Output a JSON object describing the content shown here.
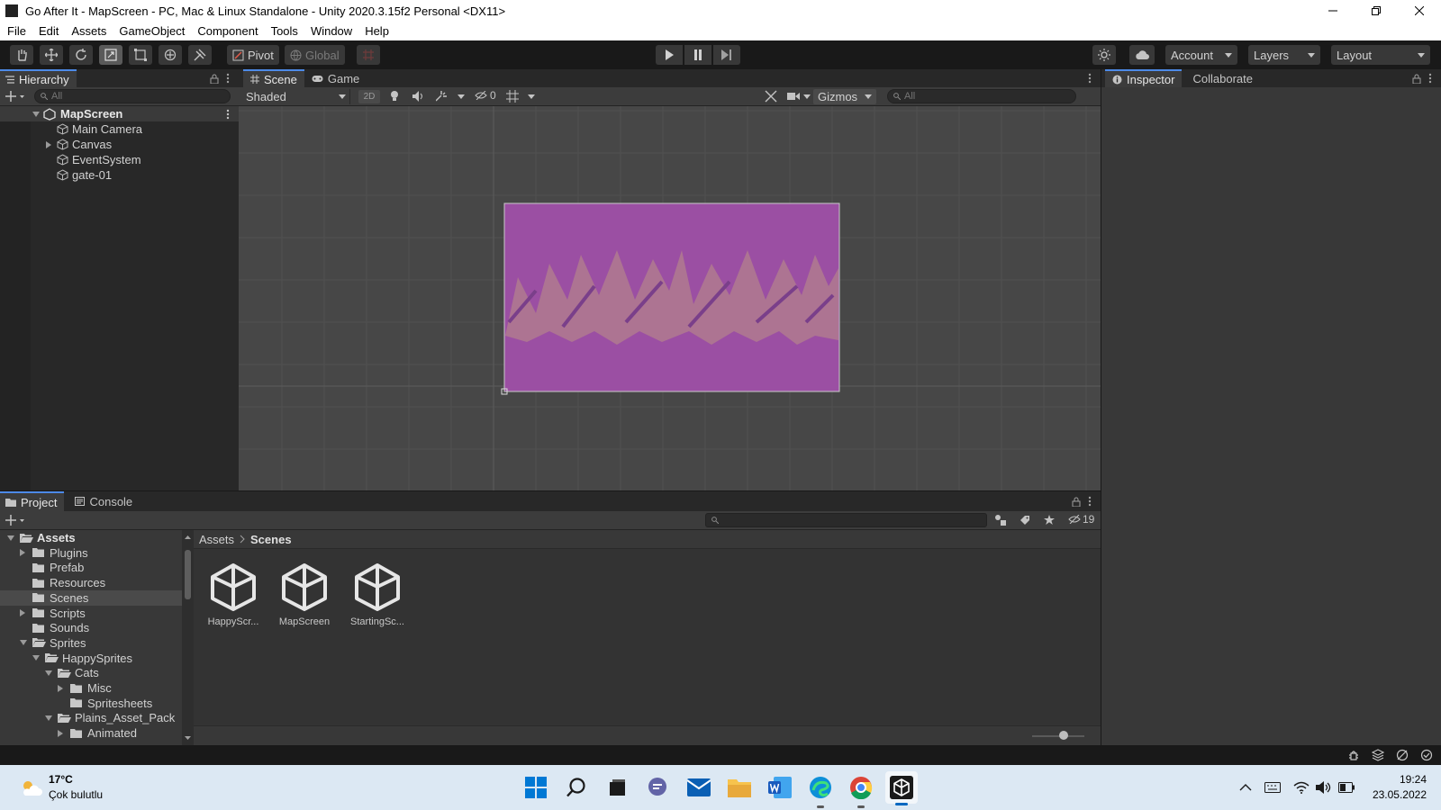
{
  "window": {
    "title": "Go After It - MapScreen - PC, Mac & Linux Standalone - Unity 2020.3.15f2 Personal <DX11>"
  },
  "menu": [
    "File",
    "Edit",
    "Assets",
    "GameObject",
    "Component",
    "Tools",
    "Window",
    "Help"
  ],
  "toolbar": {
    "pivot_label": "Pivot",
    "global_label": "Global",
    "account_label": "Account",
    "layers_label": "Layers",
    "layout_label": "Layout"
  },
  "hierarchy": {
    "tab_label": "Hierarchy",
    "search_placeholder": "All",
    "scene_name": "MapScreen",
    "items": [
      "Main Camera",
      "Canvas",
      "EventSystem",
      "gate-01"
    ]
  },
  "scene_panel": {
    "tabs": [
      "Scene",
      "Game"
    ],
    "shading_mode": "Shaded",
    "mode_2d": "2D",
    "hidden_count": "0",
    "gizmos_label": "Gizmos",
    "search_placeholder": "All",
    "sprite_tint": "#9b4fa3"
  },
  "inspector": {
    "tabs": [
      "Inspector",
      "Collaborate"
    ]
  },
  "project": {
    "tabs": [
      "Project",
      "Console"
    ],
    "hidden_count": "19",
    "breadcrumb": [
      "Assets",
      "Scenes"
    ],
    "tree": [
      {
        "label": "Assets",
        "depth": 0,
        "expand": "open",
        "bold": true
      },
      {
        "label": "Plugins",
        "depth": 1,
        "expand": "closed"
      },
      {
        "label": "Prefab",
        "depth": 1,
        "expand": "none"
      },
      {
        "label": "Resources",
        "depth": 1,
        "expand": "none"
      },
      {
        "label": "Scenes",
        "depth": 1,
        "expand": "none",
        "selected": true
      },
      {
        "label": "Scripts",
        "depth": 1,
        "expand": "closed"
      },
      {
        "label": "Sounds",
        "depth": 1,
        "expand": "none"
      },
      {
        "label": "Sprites",
        "depth": 1,
        "expand": "open"
      },
      {
        "label": "HappySprites",
        "depth": 2,
        "expand": "open"
      },
      {
        "label": "Cats",
        "depth": 3,
        "expand": "open"
      },
      {
        "label": "Misc",
        "depth": 4,
        "expand": "closed"
      },
      {
        "label": "Spritesheets",
        "depth": 4,
        "expand": "none"
      },
      {
        "label": "Plains_Asset_Pack",
        "depth": 3,
        "expand": "open"
      },
      {
        "label": "Animated",
        "depth": 4,
        "expand": "closed"
      }
    ],
    "assets": [
      "HappyScr...",
      "MapScreen",
      "StartingSc..."
    ]
  },
  "taskbar": {
    "weather_temp": "17°C",
    "weather_desc": "Çok bulutlu",
    "time": "19:24",
    "date": "23.05.2022"
  }
}
